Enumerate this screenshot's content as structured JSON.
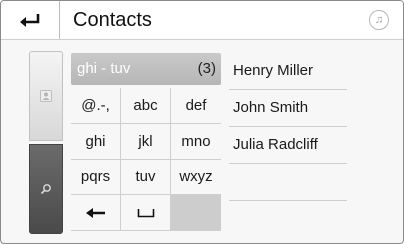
{
  "header": {
    "title": "Contacts",
    "back_icon": "back-return-icon",
    "music_icon": "music-note-icon"
  },
  "sidebar": {
    "items": [
      {
        "name": "contacts",
        "icon": "person-icon",
        "selected": false
      },
      {
        "name": "search",
        "icon": "search-icon",
        "selected": true
      }
    ]
  },
  "search": {
    "value": "ghi - tuv",
    "count": "(3)"
  },
  "keypad": {
    "keys": [
      "@.-,",
      "abc",
      "def",
      "ghi",
      "jkl",
      "mno",
      "pqrs",
      "tuv",
      "wxyz"
    ],
    "backspace_icon": "left-arrow-icon",
    "space_icon": "space-bar-icon"
  },
  "results": {
    "items": [
      "Henry Miller",
      "John Smith",
      "Julia Radcliff"
    ]
  },
  "colors": {
    "background": "#f7f7f7",
    "active_sidebar": "#4a4a4a",
    "search_field": "#c0c0c0",
    "disabled_key": "#cdcdcd"
  }
}
